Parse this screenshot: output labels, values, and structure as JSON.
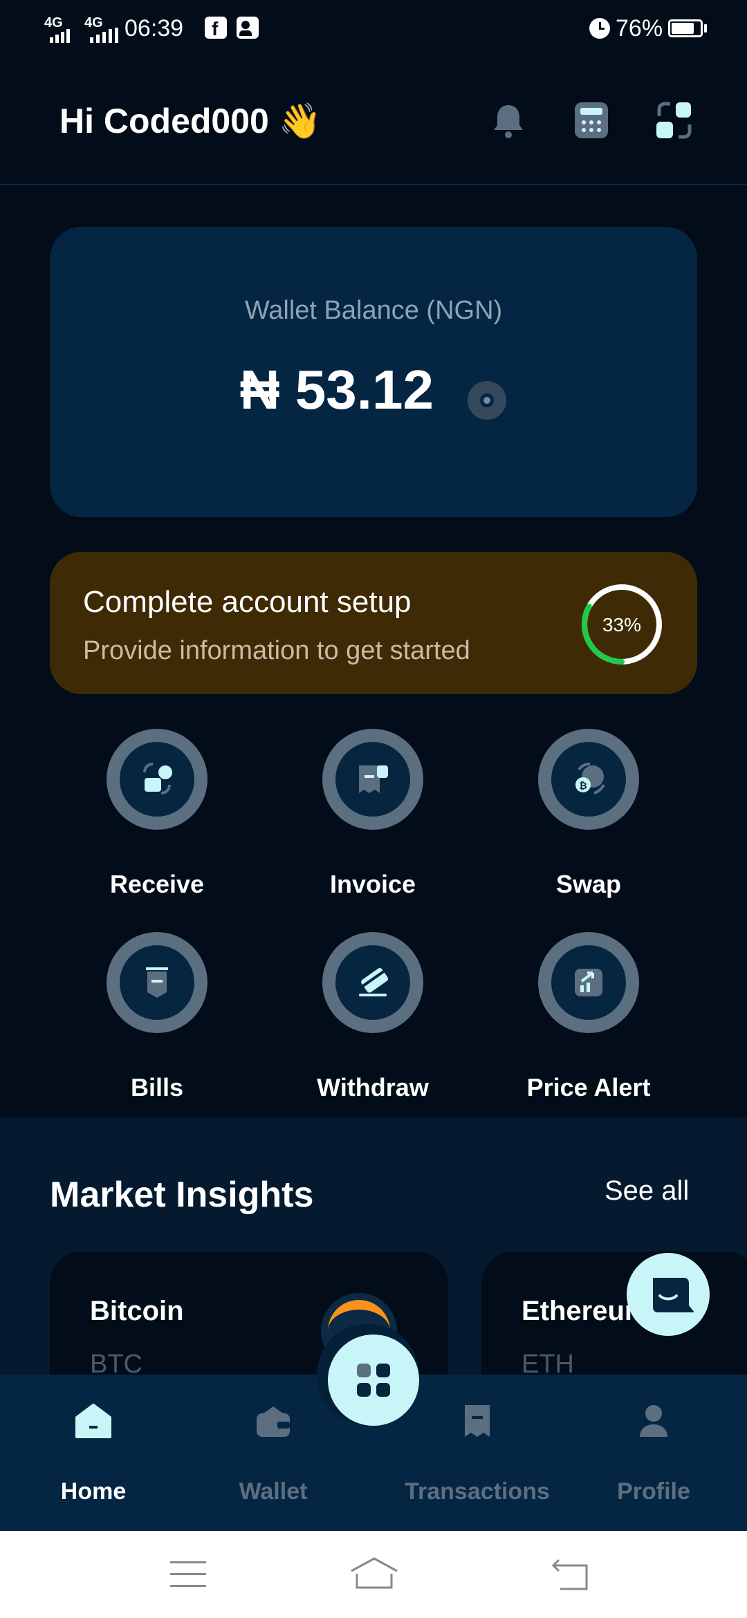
{
  "status_bar": {
    "net1": "4G",
    "net2": "4G",
    "time": "06:39",
    "battery": "76%"
  },
  "header": {
    "greeting": "Hi Coded000 👋"
  },
  "wallet": {
    "label": "Wallet Balance (NGN)",
    "amount": "₦ 53.12"
  },
  "setup": {
    "title": "Complete account setup",
    "subtitle": "Provide information to get started",
    "progress_text": "33%",
    "progress": 0.33
  },
  "actions": [
    {
      "label": "Receive"
    },
    {
      "label": "Invoice"
    },
    {
      "label": "Swap"
    },
    {
      "label": "Bills"
    },
    {
      "label": "Withdraw"
    },
    {
      "label": "Price Alert"
    }
  ],
  "market": {
    "title": "Market Insights",
    "see_all": "See all",
    "coins": [
      {
        "name": "Bitcoin",
        "symbol": "BTC"
      },
      {
        "name": "Ethereum",
        "symbol": "ETH"
      }
    ]
  },
  "bottom_nav": [
    {
      "label": "Home",
      "active": true
    },
    {
      "label": "Wallet"
    },
    {
      "label": "Transactions"
    },
    {
      "label": "Profile"
    }
  ],
  "colors": {
    "accent": "#1fc94a",
    "fab": "#c8f6f8",
    "nav_bg": "#052643"
  }
}
